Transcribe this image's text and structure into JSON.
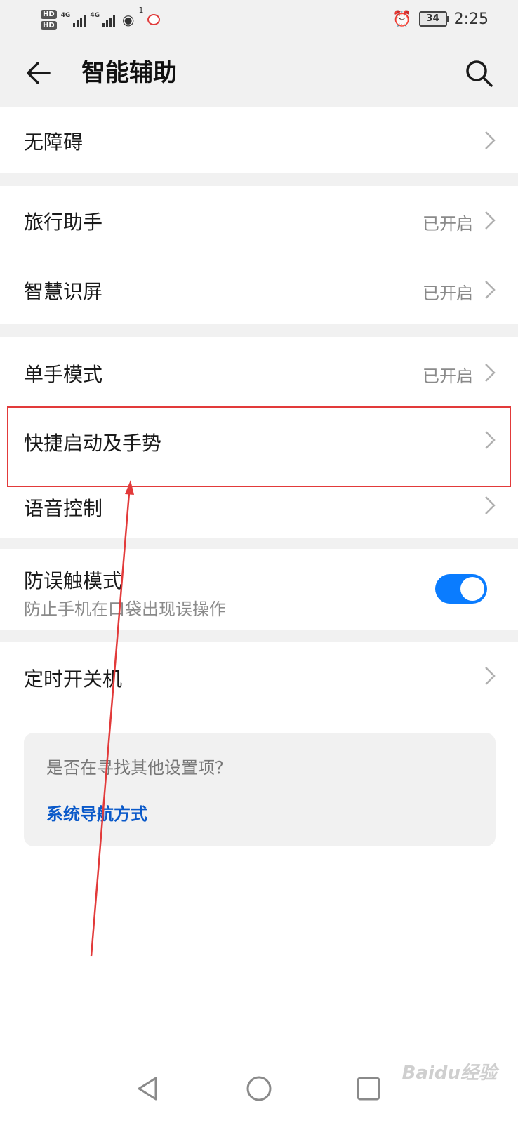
{
  "status_bar": {
    "hd1": "HD",
    "hd2": "HD",
    "net1": "4G",
    "net2": "4G",
    "hotspot_count": "1",
    "battery": "34",
    "time": "2:25"
  },
  "header": {
    "title": "智能辅助"
  },
  "groups": {
    "accessibility": {
      "label": "无障碍"
    },
    "travel": {
      "label": "旅行助手",
      "status": "已开启"
    },
    "smart_screen": {
      "label": "智慧识屏",
      "status": "已开启"
    },
    "one_hand": {
      "label": "单手模式",
      "status": "已开启"
    },
    "shortcuts": {
      "label": "快捷启动及手势"
    },
    "voice": {
      "label": "语音控制"
    },
    "pocket_mode": {
      "label": "防误触模式",
      "sub": "防止手机在口袋出现误操作",
      "enabled": true
    },
    "scheduled_power": {
      "label": "定时开关机"
    }
  },
  "suggestion": {
    "question": "是否在寻找其他设置项？",
    "link": "系统导航方式"
  },
  "watermark": "Baidu经验",
  "colors": {
    "accent": "#0a7cff",
    "link": "#0a59c9",
    "annotation": "#e23a3a",
    "background_gray": "#f1f1f1"
  }
}
